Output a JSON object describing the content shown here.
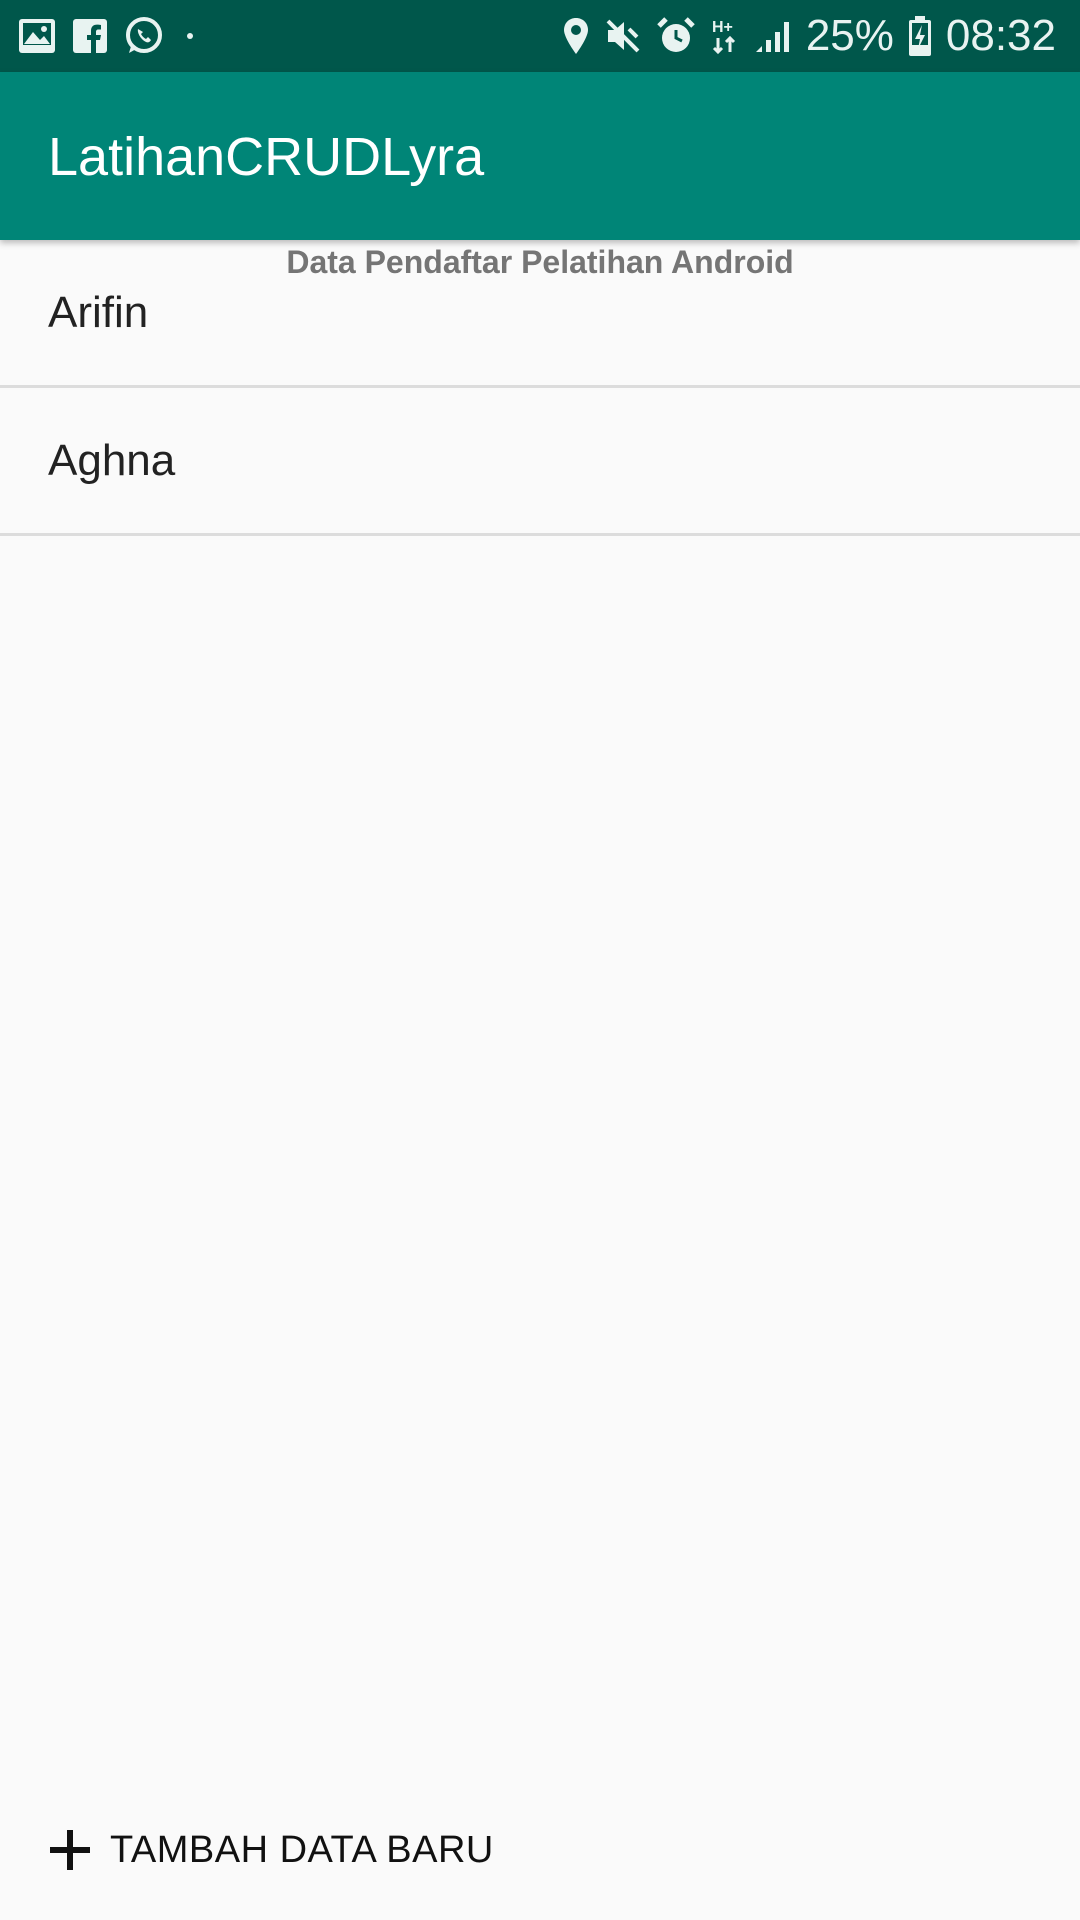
{
  "status_bar": {
    "icons_left": [
      "gallery-icon",
      "facebook-icon",
      "whatsapp-icon",
      "dot-icon"
    ],
    "icons_right": [
      "location-icon",
      "mute-icon",
      "alarm-icon",
      "data-hplus-icon",
      "signal-icon"
    ],
    "battery_percent": "25%",
    "time": "08:32",
    "background_color": "#00574b"
  },
  "app_bar": {
    "title": "LatihanCRUDLyra",
    "background_color": "#008577"
  },
  "main": {
    "subtitle": "Data Pendaftar Pelatihan Android",
    "items": [
      {
        "label": "Arifin"
      },
      {
        "label": "Aghna"
      }
    ]
  },
  "footer": {
    "add_icon": "plus-icon",
    "add_label": "TAMBAH DATA BARU"
  }
}
